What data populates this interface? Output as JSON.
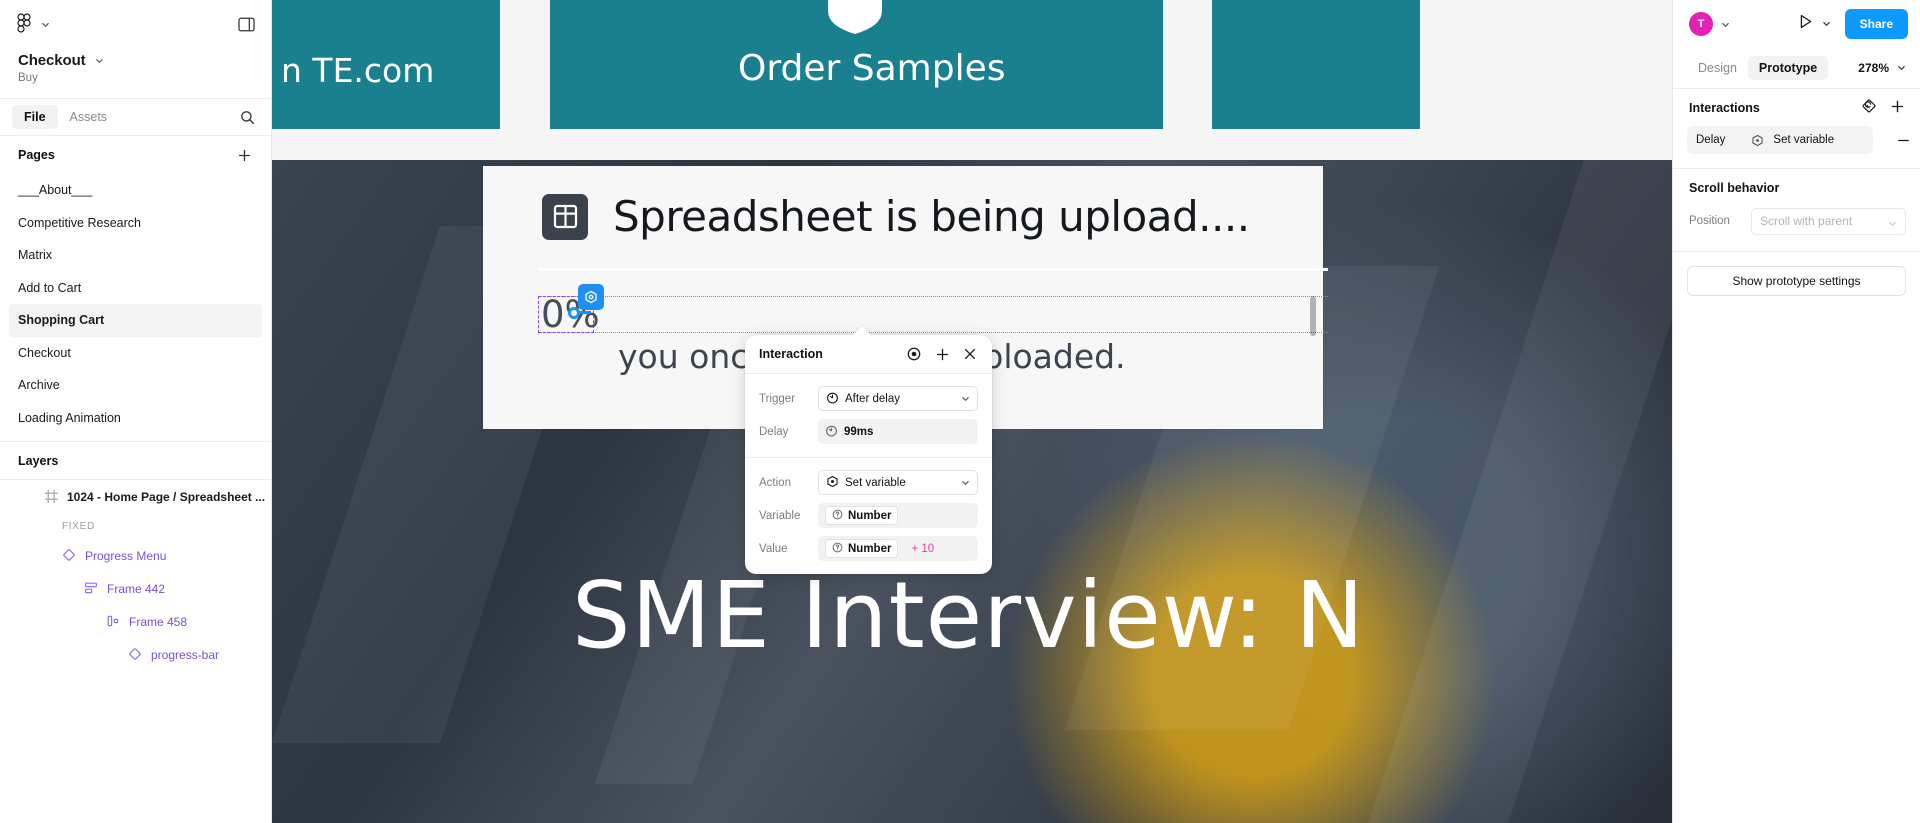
{
  "sidebar": {
    "logo_icon": "figma-logo",
    "menu_chevron_icon": "chevron-down-icon",
    "panel_toggle_icon": "panel-toggle-icon",
    "file_title": "Checkout",
    "file_subtitle": "Buy",
    "tabs": [
      {
        "label": "File",
        "active": true
      },
      {
        "label": "Assets",
        "active": false
      }
    ],
    "search_icon": "search-icon",
    "pages_header": "Pages",
    "pages_add_icon": "plus-icon",
    "pages": [
      {
        "label": "___About___",
        "selected": false
      },
      {
        "label": "Competitive Research",
        "selected": false
      },
      {
        "label": "Matrix",
        "selected": false
      },
      {
        "label": "Add to Cart",
        "selected": false
      },
      {
        "label": "Shopping Cart",
        "selected": true
      },
      {
        "label": "Checkout",
        "selected": false
      },
      {
        "label": "Archive",
        "selected": false
      },
      {
        "label": "Loading Animation",
        "selected": false
      }
    ],
    "layers_header": "Layers",
    "layers": [
      {
        "label": "1024 - Home Page / Spreadsheet ...",
        "icon": "frame-icon",
        "indent": 0,
        "type": "frame"
      },
      {
        "label": "FIXED",
        "icon": "",
        "indent": 0,
        "type": "group-label"
      },
      {
        "label": "Progress Menu",
        "icon": "component-icon",
        "indent": 1,
        "type": "component"
      },
      {
        "label": "Frame 442",
        "icon": "autolayout-vertical-icon",
        "indent": 2,
        "type": "component"
      },
      {
        "label": "Frame 458",
        "icon": "autolayout-horizontal-icon",
        "indent": 3,
        "type": "component"
      },
      {
        "label": "progress-bar",
        "icon": "component-icon",
        "indent": 4,
        "type": "component"
      }
    ]
  },
  "canvas": {
    "banner_color": "#1a7f8e",
    "banner_left_text": "n TE.com",
    "banner_center_text": "Order Samples",
    "banner_shield_icon": "shield-icon",
    "artboard": {
      "sheet_icon": "spreadsheet-icon",
      "sheet_title": "Spreadsheet is being upload....",
      "progress_percent_label": "0%",
      "upload_message": "you once your file is uploaded.",
      "photo_headline": "SME Interview: N"
    },
    "selection": {
      "node_badge_icon": "set-variable-icon",
      "selection_color": "#8b3ff0",
      "connector_color": "#1e90f5"
    }
  },
  "dialog": {
    "title": "Interaction",
    "header_icons": [
      {
        "name": "target-icon"
      },
      {
        "name": "plus-icon"
      },
      {
        "name": "close-icon"
      }
    ],
    "fields": [
      {
        "label": "Trigger",
        "value": "After delay",
        "icon": "timer-icon",
        "style": "bordered",
        "dropdown": true
      },
      {
        "label": "Delay",
        "value": "99ms",
        "icon": "timer-icon",
        "style": "filled",
        "dropdown": false
      }
    ],
    "action_fields": [
      {
        "label": "Action",
        "value": "Set variable",
        "icon": "set-variable-icon",
        "style": "bordered",
        "dropdown": true
      }
    ],
    "variable_label": "Variable",
    "variable_chip": "Number",
    "variable_chip_icon": "question-icon",
    "value_label": "Value",
    "value_chip": "Number",
    "value_chip_icon": "question-icon",
    "value_operator": "+ 10",
    "value_operator_color": "#e8429a"
  },
  "right_panel": {
    "avatar_initial": "T",
    "avatar_color": "#e321b4",
    "avatar_chevron_icon": "chevron-down-icon",
    "present_icon": "play-icon",
    "present_chevron_icon": "chevron-down-icon",
    "share_label": "Share",
    "share_color": "#0d99ff",
    "tabs": [
      {
        "label": "Design",
        "active": false
      },
      {
        "label": "Prototype",
        "active": true
      }
    ],
    "zoom_level": "278%",
    "zoom_chevron_icon": "chevron-down-icon",
    "interactions_header": "Interactions",
    "interactions_reset_icon": "reset-interaction-icon",
    "interactions_add_icon": "plus-icon",
    "interaction_items": [
      {
        "trigger": "Delay",
        "action_icon": "set-variable-icon",
        "action": "Set variable",
        "remove_icon": "minus-icon"
      }
    ],
    "scroll_header": "Scroll behavior",
    "position_label": "Position",
    "position_value": "Scroll with parent",
    "position_chevron_icon": "chevron-down-icon",
    "prototype_settings_label": "Show prototype settings"
  }
}
